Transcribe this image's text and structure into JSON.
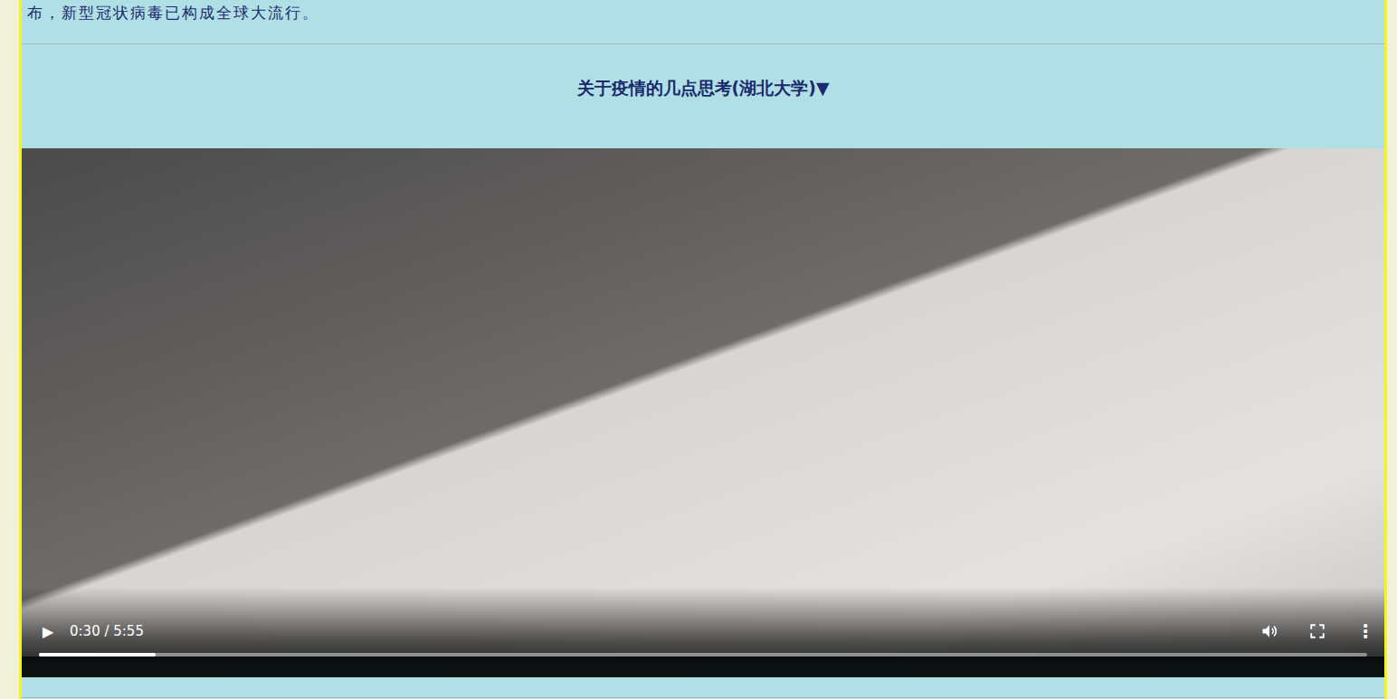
{
  "intro": {
    "text": "布，新型冠状病毒已构成全球大流行。"
  },
  "section": {
    "title": "关于疫情的几点思考(湖北大学)",
    "toggle": "▼"
  },
  "video": {
    "play_icon": "▶",
    "time": "0:30 / 5:55",
    "level": 0.088,
    "muted": false,
    "more_icon": "⋮"
  }
}
